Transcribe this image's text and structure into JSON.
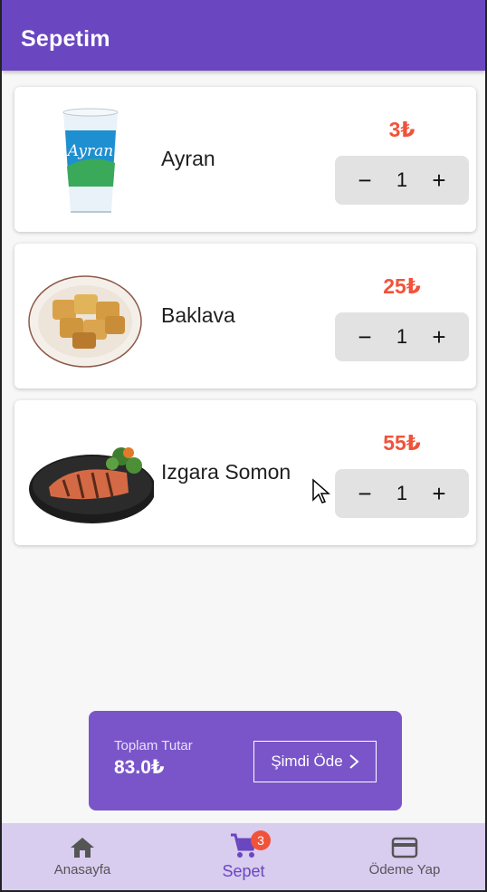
{
  "appbar": {
    "title": "Sepetim"
  },
  "cart": {
    "items": [
      {
        "name": "Ayran",
        "price": "3₺",
        "quantity": "1",
        "minus": "−",
        "plus": "+"
      },
      {
        "name": "Baklava",
        "price": "25₺",
        "quantity": "1",
        "minus": "−",
        "plus": "+"
      },
      {
        "name": "Izgara Somon",
        "price": "55₺",
        "quantity": "1",
        "minus": "−",
        "plus": "+"
      }
    ]
  },
  "summary": {
    "total_label": "Toplam Tutar",
    "total_value": "83.0₺",
    "pay_button": "Şimdi Öde"
  },
  "bottom_nav": {
    "items": [
      {
        "label": "Anasayfa",
        "icon": "home-icon"
      },
      {
        "label": "Sepet",
        "icon": "cart-icon",
        "badge": "3"
      },
      {
        "label": "Ödeme Yap",
        "icon": "credit-card-icon"
      }
    ]
  },
  "colors": {
    "primary": "#6a46c0",
    "price": "#f0533a",
    "total_box": "#7a55c9",
    "nav_bg": "#d8ccef"
  }
}
